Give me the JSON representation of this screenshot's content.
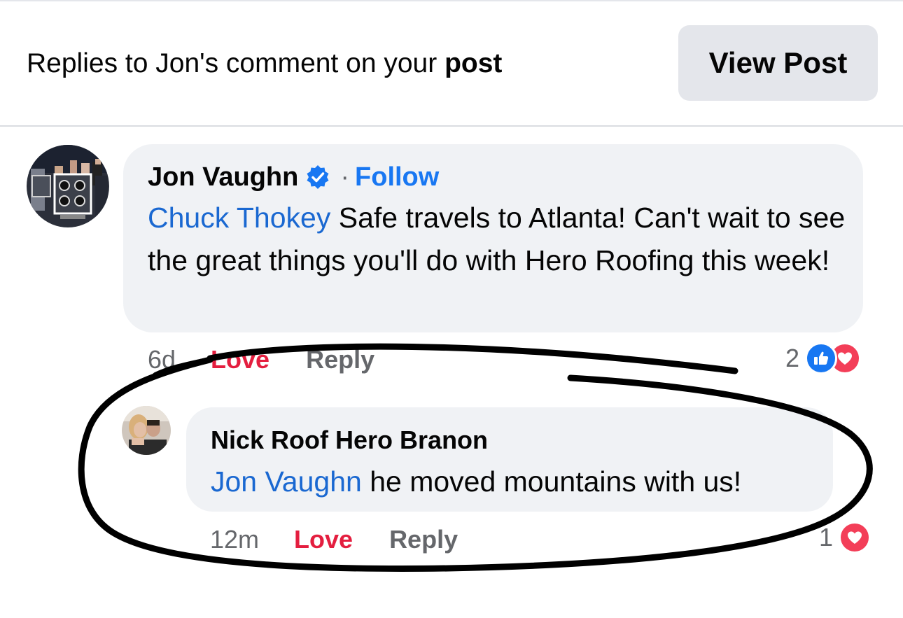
{
  "header": {
    "title_prefix": "Replies to Jon's comment on your ",
    "title_bold": "post",
    "view_post_label": "View Post"
  },
  "comments": [
    {
      "author": "Jon Vaughn",
      "verified": true,
      "separator": "·",
      "follow_label": "Follow",
      "mention": "Chuck Thokey",
      "text": " Safe travels to Atlanta! Can't wait to see the great things you'll do with Hero Roofing this week!",
      "time": "6d",
      "love_label": "Love",
      "reply_label": "Reply",
      "reaction_count": "2",
      "reactions": [
        "like-icon",
        "love-icon"
      ]
    },
    {
      "author": "Nick Roof Hero Branon",
      "mention": "Jon Vaughn",
      "text": " he moved mountains with us!",
      "time": "12m",
      "love_label": "Love",
      "reply_label": "Reply",
      "reaction_count": "1",
      "reactions": [
        "love-icon"
      ]
    }
  ],
  "colors": {
    "link_blue": "#1877f2",
    "mention_blue": "#1a68d1",
    "love_red": "#e41e3f",
    "bubble_bg": "#f0f2f5",
    "secondary_text": "#65676b"
  }
}
